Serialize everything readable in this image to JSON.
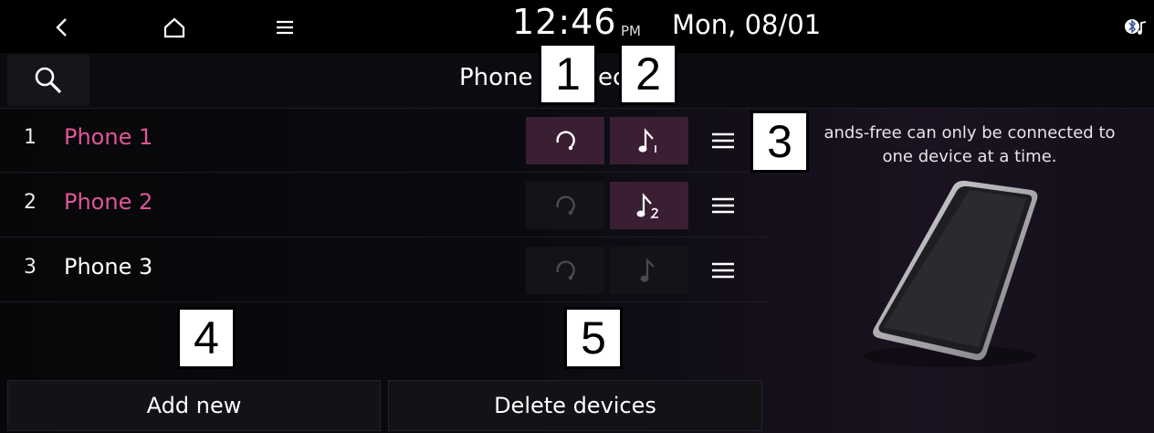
{
  "status_bar": {
    "time": "12:46",
    "ampm": "PM",
    "date": "Mon, 08/01",
    "icons": [
      "back-icon",
      "home-icon",
      "menu-icon",
      "bluetooth-audio-icon"
    ]
  },
  "header": {
    "title": "Phone connection"
  },
  "devices": [
    {
      "index": "1",
      "name": "Phone 1",
      "name_color": "#e0569a",
      "handsfree_active": true,
      "audio_active": true,
      "audio_icon": "music-note-1-icon"
    },
    {
      "index": "2",
      "name": "Phone 2",
      "name_color": "#e0569a",
      "handsfree_active": false,
      "audio_active": true,
      "audio_icon": "music-note-2-icon"
    },
    {
      "index": "3",
      "name": "Phone 3",
      "name_color": "#ffffff",
      "handsfree_active": false,
      "audio_active": false,
      "audio_icon": "music-note-icon"
    }
  ],
  "info_panel": {
    "line1": "ands-free can only be connected to",
    "line2": "one device at a time."
  },
  "buttons": {
    "add_new": "Add new",
    "delete_devices": "Delete devices"
  },
  "callouts": [
    "1",
    "2",
    "3",
    "4",
    "5"
  ],
  "colors": {
    "accent": "#e0569a",
    "active_button_bg": "#3a1f34",
    "inactive_button_bg": "#131318"
  }
}
